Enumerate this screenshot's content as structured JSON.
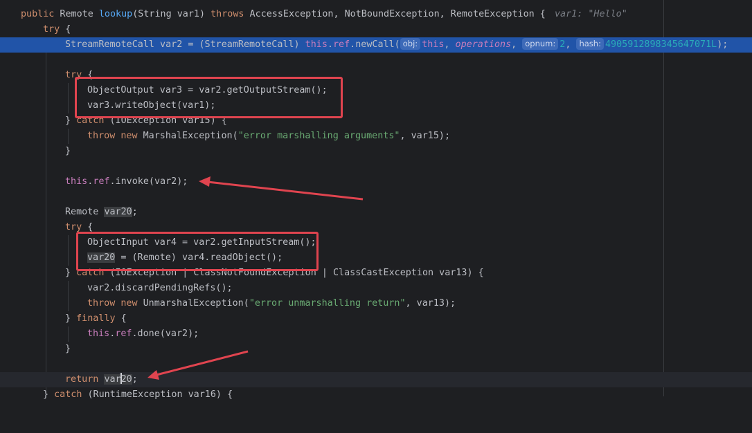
{
  "lines": {
    "l1": {
      "kw1": "public",
      "t1": " Remote ",
      "fn": "lookup",
      "t2": "(String var1) ",
      "kw2": "throws",
      "t3": " AccessException, NotBoundException, RemoteException {",
      "hint": "var1: \"Hello\""
    },
    "l2": {
      "kw": "try",
      "t": " {"
    },
    "l3": {
      "t1": "StreamRemoteCall var2 = (StreamRemoteCall) ",
      "this": "this",
      "dot1": ".",
      "ref": "ref",
      "t2": ".newCall(",
      "p1": "obj:",
      "a1": "this",
      "c1": ", ",
      "a2": "operations",
      "c2": ", ",
      "p2": "opnum:",
      "a3": "2",
      "c3": ", ",
      "p3": "hash:",
      "a4": "4905912898345647071L",
      "t3": ");"
    },
    "l5": {
      "kw": "try",
      "t": " {"
    },
    "l6": {
      "t": "ObjectOutput var3 = var2.getOutputStream();"
    },
    "l7": {
      "t": "var3.writeObject(var1);"
    },
    "l8": {
      "t1": "} ",
      "kw": "catch",
      "t2": " (IOException var15) {"
    },
    "l9": {
      "kw1": "throw",
      "s": " ",
      "kw2": "new",
      "t1": " MarshalException(",
      "str": "\"error marshalling arguments\"",
      "t2": ", var15);"
    },
    "l10": {
      "t": "}"
    },
    "l12": {
      "this": "this",
      "dot": ".",
      "ref": "ref",
      "t": ".invoke(var2);"
    },
    "l14": {
      "t1": "Remote ",
      "var": "var20",
      "t2": ";"
    },
    "l15": {
      "kw": "try",
      "t": " {"
    },
    "l16": {
      "t": "ObjectInput var4 = var2.getInputStream();"
    },
    "l17": {
      "var": "var20",
      "t": " = (Remote) var4.readObject();"
    },
    "l18": {
      "t1": "} ",
      "kw": "catch",
      "t2": " (IOException | ClassNotFoundException | ClassCastException var13) {"
    },
    "l19": {
      "t": "var2.discardPendingRefs();"
    },
    "l20": {
      "kw1": "throw",
      "s": " ",
      "kw2": "new",
      "t1": " UnmarshalException(",
      "str": "\"error unmarshalling return\"",
      "t2": ", var13);"
    },
    "l21": {
      "t1": "} ",
      "kw": "finally",
      "t2": " {"
    },
    "l22": {
      "this": "this",
      "dot": ".",
      "ref": "ref",
      "t": ".done(var2);"
    },
    "l23": {
      "t": "}"
    },
    "l25": {
      "kw": "return",
      "s": " ",
      "v1": "var",
      "v2": "20",
      "t": ";"
    },
    "l26": {
      "t1": "} ",
      "kw": "catch",
      "t2": " (RuntimeException var16) {"
    }
  },
  "colors": {
    "background": "#1e1f22",
    "execution_line": "#2154a8",
    "keyword": "#cf8e6d",
    "method": "#56a8f5",
    "field": "#c77dbb",
    "string": "#6aab73",
    "annotation": "#e0444f"
  }
}
